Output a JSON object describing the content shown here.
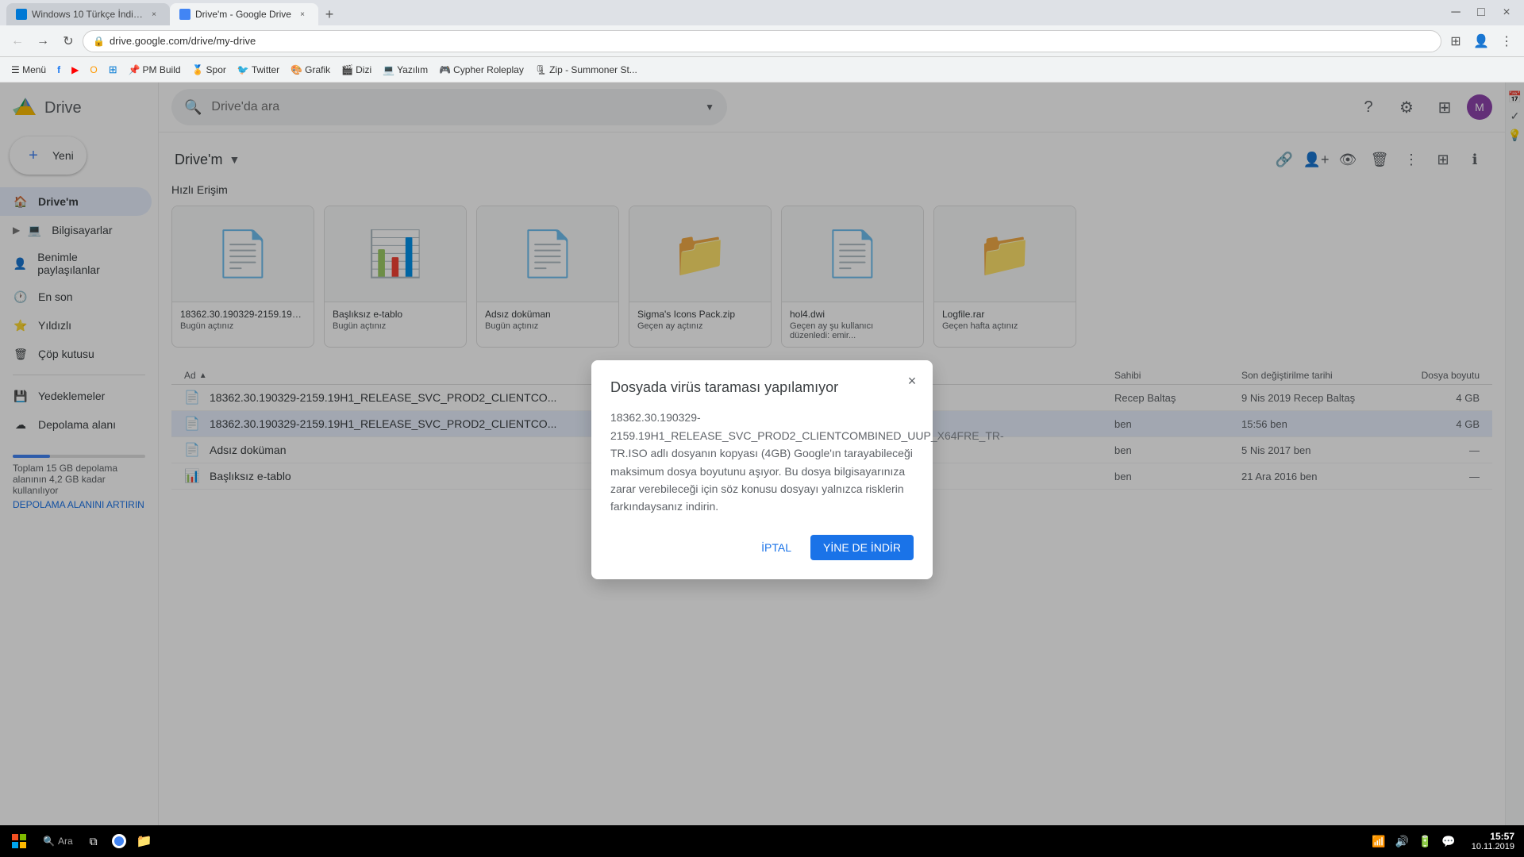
{
  "browser": {
    "tabs": [
      {
        "id": "tab1",
        "title": "Windows 10 Türkçe İndirm...",
        "active": false,
        "favicon_color": "#0078d4"
      },
      {
        "id": "tab2",
        "title": "Drive'm - Google Drive",
        "active": true,
        "favicon_color": "#4285f4"
      }
    ],
    "new_tab_label": "+",
    "url": "drive.google.com/drive/my-drive",
    "lock_icon": "🔒"
  },
  "bookmarks": [
    {
      "label": "Menü",
      "color": "#555"
    },
    {
      "label": "f",
      "color": "#1877f2"
    },
    {
      "label": "y",
      "color": "#f00"
    },
    {
      "label": "o",
      "color": "#f90"
    },
    {
      "label": "W",
      "color": "#0078d4"
    },
    {
      "label": "PM Build",
      "color": "#555"
    },
    {
      "label": "Spor",
      "color": "#555"
    },
    {
      "label": "Twitter",
      "color": "#1da1f2"
    },
    {
      "label": "Grafik",
      "color": "#555"
    },
    {
      "label": "Dizi",
      "color": "#555"
    },
    {
      "label": "Yazılım",
      "color": "#555"
    },
    {
      "label": "Cypher Roleplay",
      "color": "#555"
    },
    {
      "label": "Zip - Summoner St...",
      "color": "#555"
    }
  ],
  "drive": {
    "logo_text": "Drive",
    "new_button_label": "Yeni",
    "search_placeholder": "Drive'da ara",
    "breadcrumb": "Drive'm",
    "quick_access_title": "Hızlı Erişim",
    "files_section_title": "Ad",
    "sidebar_items": [
      {
        "id": "drive",
        "label": "Drive'm",
        "active": true
      },
      {
        "id": "computers",
        "label": "Bilgisayarlar",
        "active": false
      },
      {
        "id": "shared",
        "label": "Benimle paylaşılanlar",
        "active": false
      },
      {
        "id": "recent",
        "label": "En son",
        "active": false
      },
      {
        "id": "starred",
        "label": "Yıldızlı",
        "active": false
      },
      {
        "id": "trash",
        "label": "Çöp kutusu",
        "active": false
      },
      {
        "id": "backups",
        "label": "Yedeklemeler",
        "active": false
      },
      {
        "id": "storage",
        "label": "Depolama alanı",
        "active": false
      }
    ],
    "storage": {
      "label": "Depolama alanı",
      "details": "Toplam 15 GB depolama alanının 4,2 GB kadar kullanılıyor",
      "upgrade_label": "DEPOLAMA ALANINI ARTIRIN",
      "fill_percent": 28
    },
    "quick_files": [
      {
        "name": "18362.30.190329-2159.19H...",
        "date": "Bugün açtınız",
        "icon": "📄",
        "icon_color": "#4285f4"
      },
      {
        "name": "Başlıksız e-tablo",
        "date": "Bugün açtınız",
        "icon": "📊",
        "icon_color": "#0f9d58"
      },
      {
        "name": "Adsız doküman",
        "date": "Bugün açtınız",
        "icon": "📄",
        "icon_color": "#4285f4"
      },
      {
        "name": "Sigma's Icons Pack.zip",
        "date": "Geçen ay açtınız",
        "icon": "📁",
        "icon_color": "#607d8b"
      },
      {
        "name": "hol4.dwi",
        "date": "Geçen ay şu kullanıcı düzenledi: emir...",
        "icon": "📄",
        "icon_color": "#4285f4"
      },
      {
        "name": "Logfile.rar",
        "date": "Geçen hafta açtınız",
        "icon": "📁",
        "icon_color": "#607d8b"
      }
    ],
    "file_list": [
      {
        "name": "18362.30.190329-2159.19H1_RELEASE_SVC_PROD2_CLIENTCO...",
        "owner": "Recep Baltaş",
        "modified": "9 Nis 2019 Recep Baltaş",
        "size": "4 GB",
        "icon": "📄",
        "highlighted": false
      },
      {
        "name": "18362.30.190329-2159.19H1_RELEASE_SVC_PROD2_CLIENTCO...",
        "owner": "ben",
        "modified": "15:56 ben",
        "size": "4 GB",
        "icon": "📄",
        "highlighted": true
      },
      {
        "name": "Adsız doküman",
        "owner": "ben",
        "modified": "5 Nis 2017 ben",
        "size": "—",
        "icon": "📄",
        "highlighted": false
      },
      {
        "name": "Başlıksız e-tablo",
        "owner": "ben",
        "modified": "21 Ara 2016 ben",
        "size": "—",
        "icon": "📊",
        "highlighted": false
      }
    ],
    "list_headers": {
      "name": "Ad",
      "owner": "Sahibi",
      "modified": "Son değiştirilme tarihi",
      "size": "Dosya boyutu"
    }
  },
  "dialog": {
    "title": "Dosyada virüs taraması yapılamıyor",
    "body": "18362.30.190329-2159.19H1_RELEASE_SVC_PROD2_CLIENTCOMBINED_UUP_X64FRE_TR-TR.ISO adlı dosyanın kopyası (4GB) Google'ın tarayabileceği maksimum dosya boyutunu aşıyor. Bu dosya bilgisayarınıza zarar verebileceği için söz konusu dosyayı yalnızca risklerin farkındaysanız indirin.",
    "cancel_label": "İPTAL",
    "confirm_label": "YİNE DE İNDİR",
    "close_icon": "×"
  },
  "taskbar": {
    "time": "15:57",
    "date": "10.11.2019",
    "start_icon": "⊞",
    "search_placeholder": "Ara"
  }
}
